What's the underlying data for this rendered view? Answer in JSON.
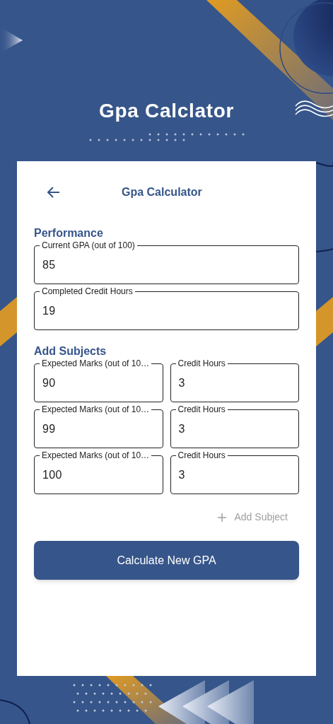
{
  "app_title": "Gpa Calclator",
  "card": {
    "header_title": "Gpa Calculator",
    "performance": {
      "heading": "Performance",
      "fields": [
        {
          "label": "Current GPA (out of 100)",
          "value": "85"
        },
        {
          "label": "Completed Credit Hours",
          "value": "19"
        }
      ]
    },
    "subjects": {
      "heading": "Add Subjects",
      "rows": [
        {
          "marks": {
            "label": "Expected Marks (out of 10…",
            "value": "90"
          },
          "credit_hours": {
            "label": "Credit Hours",
            "value": "3"
          }
        },
        {
          "marks": {
            "label": "Expected Marks (out of 10…",
            "value": "99"
          },
          "credit_hours": {
            "label": "Credit Hours",
            "value": "3"
          }
        },
        {
          "marks": {
            "label": "Expected Marks (out of 10…",
            "value": "100"
          },
          "credit_hours": {
            "label": "Credit Hours",
            "value": "3"
          }
        }
      ]
    },
    "add_subject_button": "Add Subject",
    "calculate_button": "Calculate New GPA"
  }
}
